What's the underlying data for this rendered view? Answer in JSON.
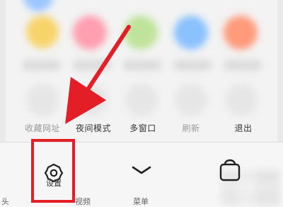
{
  "top_row_colors": [
    "#f7d46a",
    "#ff9fb0",
    "#bfe39a",
    "#8ac1ff",
    "#ff9a7a"
  ],
  "menu_items": [
    {
      "label": "收藏网址",
      "dim": true
    },
    {
      "label": "夜间模式"
    },
    {
      "label": "多窗口"
    },
    {
      "label": "刷新",
      "dim": true
    },
    {
      "label": "退出"
    }
  ],
  "bottom_bar": {
    "left_label": "头",
    "settings_label": "设置",
    "videos_label": "视频",
    "menu_label": "菜单"
  },
  "annotation": {
    "color": "#e41e26"
  },
  "icons": {
    "settings": "gear-icon",
    "collapse": "chevron-down-icon",
    "third": "bag-icon"
  }
}
